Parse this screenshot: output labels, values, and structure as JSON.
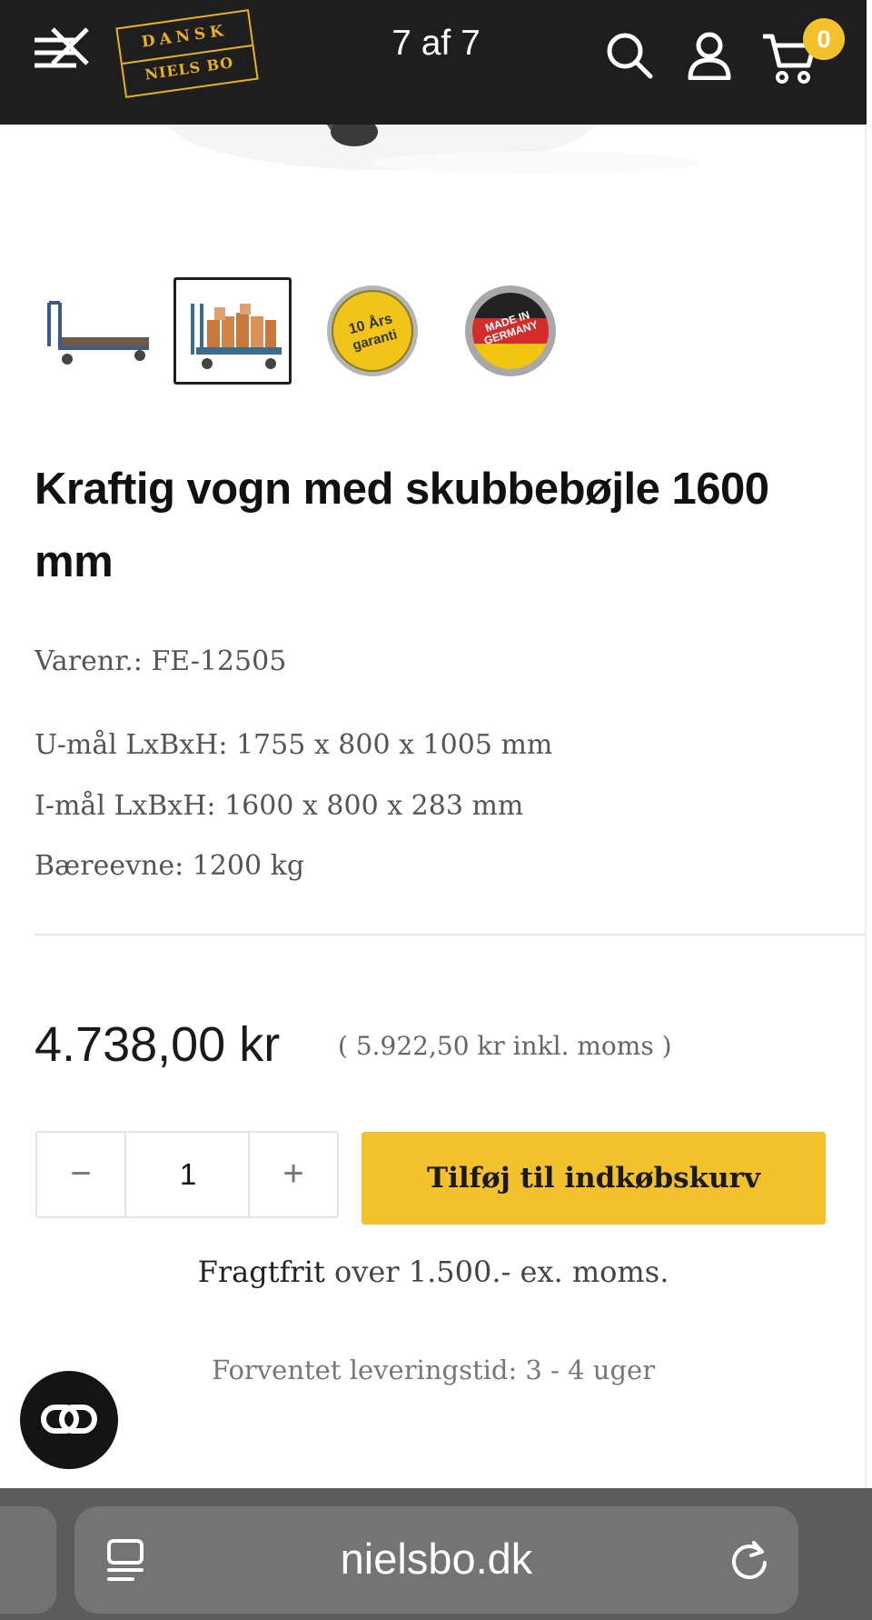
{
  "header": {
    "image_counter": "7 af 7",
    "logo_line1": "DANSK",
    "logo_line2": "NIELS BO",
    "cart_count": "0",
    "colors": {
      "background": "#1e1e1e",
      "accent": "#f3c12b"
    },
    "icons": [
      "menu-close-icon",
      "search-icon",
      "user-icon",
      "cart-icon"
    ]
  },
  "thumbnails": [
    {
      "name": "cart-empty",
      "active": false
    },
    {
      "name": "cart-with-load",
      "active": true
    },
    {
      "name": "warranty-badge",
      "text": "10 Års garanti",
      "active": false
    },
    {
      "name": "made-in-germany-badge",
      "text": "MADE IN GERMANY",
      "active": false
    }
  ],
  "product": {
    "title": "Kraftig vogn med skubbebøjle 1600 mm",
    "sku": "Varenr.: FE-12505",
    "outer_dims": "U-mål LxBxH: 1755 x 800 x 1005 mm",
    "inner_dims": "I-mål LxBxH: 1600 x 800 x 283 mm",
    "capacity": "Bæreevne: 1200 kg",
    "price": "4.738,00 kr",
    "price_incl": "( 5.922,50 kr inkl. moms )",
    "quantity": "1",
    "minus_label": "−",
    "plus_label": "+",
    "add_to_cart": "Tilføj til indkøbskurv",
    "shipping_bold": "Fragtfrit",
    "shipping_rest": " over 1.500.- ex. moms.",
    "delivery": "Forventet leveringstid: 3 - 4 uger"
  },
  "browser": {
    "url": "nielsbo.dk",
    "icons": [
      "reader-icon",
      "reload-icon"
    ]
  },
  "chat": {
    "icon": "chat-link-icon"
  }
}
